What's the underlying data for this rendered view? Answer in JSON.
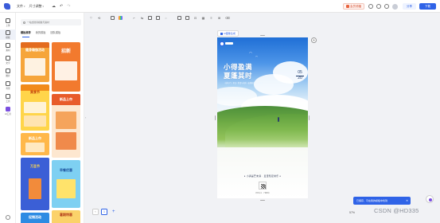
{
  "header": {
    "menu_file": "文件",
    "menu_resize": "尺寸调整",
    "vip_label": "会员领福",
    "share_label": "分享",
    "download_label": "下载"
  },
  "rail": {
    "items": [
      {
        "label": "上传"
      },
      {
        "label": "模板"
      },
      {
        "label": "素材"
      },
      {
        "label": "文字"
      },
      {
        "label": "图片"
      },
      {
        "label": "背景"
      },
      {
        "label": "工具"
      },
      {
        "label": "AI工具"
      }
    ]
  },
  "panel": {
    "search_placeholder": "一站式搜索模板与素材",
    "tabs": [
      {
        "label": "模板推荐"
      },
      {
        "label": "我的模板"
      },
      {
        "label": "团队模板"
      }
    ],
    "templates": [
      {
        "title": "健身瑜伽活动"
      },
      {
        "title": "招新"
      },
      {
        "title": "美食节"
      },
      {
        "title": "新品上市"
      },
      {
        "title": "万圣节"
      },
      {
        "title": "早餐优惠"
      },
      {
        "title": "促销活动"
      },
      {
        "title": "暑期特惠"
      }
    ]
  },
  "canvas": {
    "page_pill": "AI图像生成",
    "poster": {
      "title_line1": "小得盈满",
      "title_line2": "夏蓬其时",
      "subtitle": "小满节气 / 夏日 / 希望与收获 / 麦穗渐满 / 万物繁茂",
      "date_month": "05",
      "date_day": "20",
      "tagline": "♦ 小满是芒未满 · 爱里知足常乐 ♦",
      "footer": "扫码关注 · 了解更多"
    }
  },
  "bottom": {
    "page_prev": "‹",
    "page_current": "1",
    "zoom": "57%",
    "toast_text": "已保存，可在我的模板中找到",
    "watermark": "CSDN @HD335"
  },
  "colors": {
    "accent": "#2f63e7",
    "vip": "#e8633e",
    "ai_purple": "#7b4fe0"
  }
}
